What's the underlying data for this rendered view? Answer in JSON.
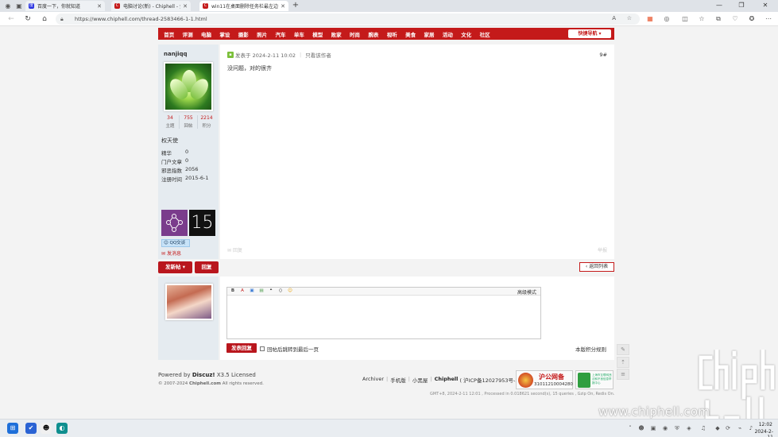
{
  "browser": {
    "tabs": [
      {
        "label": "百度一下，你就知道",
        "favicon_color": "#2932e1",
        "active": false
      },
      {
        "label": "电脑讨论(新) - Chiphell - 分享与",
        "favicon_color": "#c41a1a",
        "active": false
      },
      {
        "label": "win11在桌面删除任务栏最左边的",
        "favicon_color": "#c41a1a",
        "active": true
      }
    ],
    "url": "https://www.chiphell.com/thread-2583466-1-1.html",
    "icons": [
      "profile-icon",
      "tab-actions-icon",
      "close-icon",
      "add-tab-icon",
      "minimize-icon",
      "maximize-icon",
      "window-close-icon",
      "back-icon",
      "reload-icon",
      "home-icon",
      "lock-icon",
      "read-aloud-icon",
      "favorite-icon",
      "extension-icon",
      "split-screen-icon",
      "favorites-icon",
      "collections-icon",
      "browser-essentials-icon",
      "settings-icon"
    ]
  },
  "nav": {
    "items": [
      "首页",
      "评测",
      "电脑",
      "掌设",
      "摄影",
      "照片",
      "汽车",
      "单车",
      "模型",
      "败家",
      "时尚",
      "腕表",
      "视听",
      "美食",
      "家居",
      "活动",
      "文化",
      "社区"
    ],
    "quick_nav": "快捷导航 ▾"
  },
  "post": {
    "author": "nanjiqq",
    "stats": [
      {
        "value": "34",
        "label": "主题"
      },
      {
        "value": "755",
        "label": "回帖"
      },
      {
        "value": "2214",
        "label": "积分"
      }
    ],
    "rank": "权天使",
    "info": [
      {
        "label": "精华",
        "value": "0"
      },
      {
        "label": "门户文章",
        "value": "0"
      },
      {
        "label": "邪恶指数",
        "value": "2056"
      },
      {
        "label": "注册时间",
        "value": "2015-6-1"
      }
    ],
    "medal_number": "15",
    "qq_label": "QQ交谈",
    "pm_label": "发消息",
    "posted_at": "发表于 2024-2-11 10:02",
    "author_only": "只看该作者",
    "floor": "9#",
    "body": "没问题，对的很齐",
    "reply_label": "回复",
    "report_label": "举报"
  },
  "actions": {
    "new_post": "发新帖 ▾",
    "reply": "回复",
    "back_to_list": "返回列表"
  },
  "reply_box": {
    "advanced_mode": "高级模式",
    "submit": "发表回复",
    "jump_last": "回帖后跳转到最后一页",
    "rules": "本版积分规则",
    "toolbar": [
      "B",
      "A",
      "▣",
      "▤",
      "❝",
      "⟨⟩",
      "☺"
    ]
  },
  "footer": {
    "powered_by_prefix": "Powered by",
    "powered_by_product": "Discuz!",
    "powered_by_suffix": "X3.5 Licensed",
    "copyright_prefix": "© 2007-2024",
    "copyright_site": "Chiphell.com",
    "copyright_suffix": "All rights reserved.",
    "links": [
      "Archiver",
      "手机版",
      "小黑屋"
    ],
    "site_name": "Chiphell",
    "icp": "( 沪ICP备12027953号-5 )",
    "badge1_title": "沪公网备",
    "badge1_number": "31011210004280",
    "badge2_text": "上海市互联网违法和不良信息举报中心",
    "gmt": "GMT+8, 2024-2-11 12:01 , Processed in 0.018621 second(s), 15 queries , Gzip On, Redis On."
  },
  "watermark": {
    "text": "www.chiphell.com"
  },
  "taskbar": {
    "time": "12:02",
    "date": "2024-2-11"
  },
  "colors": {
    "brand_red": "#c41a1a",
    "sidebar_bg": "#e5ebf0"
  }
}
